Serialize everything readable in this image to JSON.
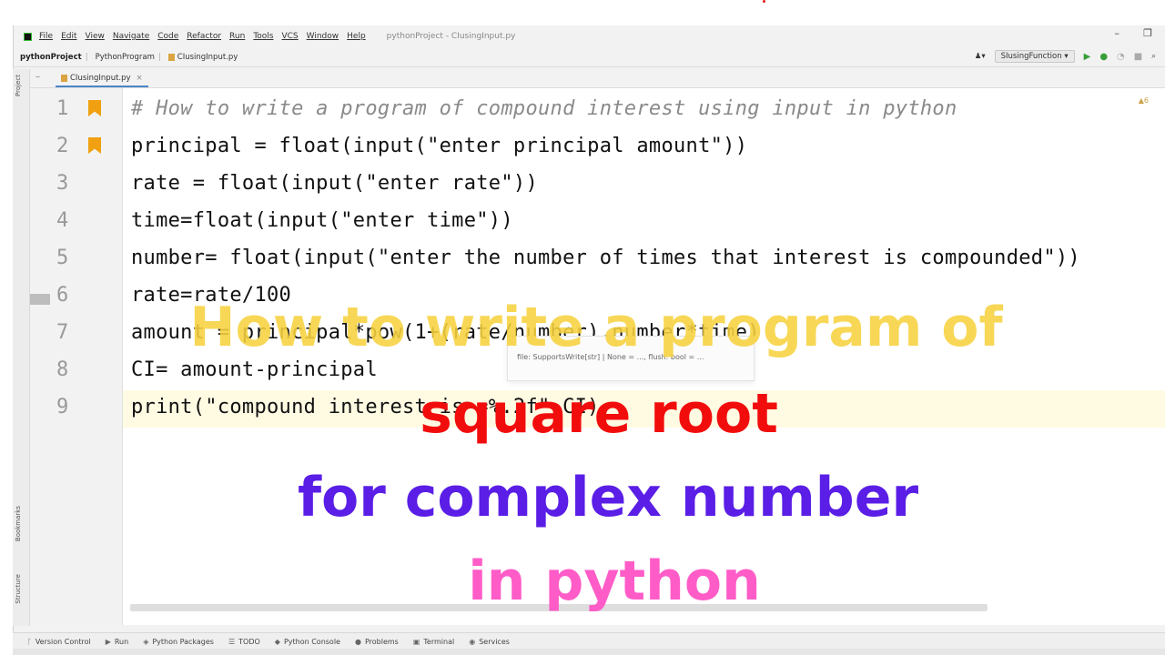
{
  "menu": {
    "items": [
      "File",
      "Edit",
      "View",
      "Navigate",
      "Code",
      "Refactor",
      "Run",
      "Tools",
      "VCS",
      "Window",
      "Help"
    ],
    "window_title": "pythonProject - CIusingInput.py"
  },
  "nav": {
    "breadcrumbs": [
      "pythonProject",
      "PythonProgram",
      "CIusingInput.py"
    ],
    "run_config": "SIusingFunction"
  },
  "editor": {
    "tab_label": "CIusingInput.py",
    "warnings": "▲6",
    "lines": [
      {
        "num": "1",
        "text": "# How to write a program of compound interest using input in python"
      },
      {
        "num": "2",
        "text": "principal = float(input(\"enter principal amount\"))"
      },
      {
        "num": "3",
        "text": "rate = float(input(\"enter rate\"))"
      },
      {
        "num": "4",
        "text": "time=float(input(\"enter time\"))"
      },
      {
        "num": "5",
        "text": "number= float(input(\"enter the number of times that interest is compounded\"))"
      },
      {
        "num": "6",
        "text": "rate=rate/100"
      },
      {
        "num": "7",
        "text": "amount = principal*pow(1+(rate/number),number*time)"
      },
      {
        "num": "8",
        "text": "CI= amount-principal"
      },
      {
        "num": "9",
        "text": "print(\"compound interest is =%.2f\",CI)"
      }
    ],
    "popup_text": "file: SupportsWrite[str] | None = ..., flush: bool = ..."
  },
  "bottom_tabs": [
    "Version Control",
    "Run",
    "Python Packages",
    "TODO",
    "Python Console",
    "Problems",
    "Terminal",
    "Services"
  ],
  "side_labels": [
    "Project",
    "Bookmarks",
    "Structure"
  ],
  "overlay": {
    "line1": "How to write a program of",
    "line2": "square root",
    "line3": "for complex number",
    "line4": "in python"
  },
  "colors": {
    "line1": "#f7d23e",
    "line2": "#f20d0d",
    "line3": "#5a1ee6",
    "line4": "#ff5cc8"
  }
}
